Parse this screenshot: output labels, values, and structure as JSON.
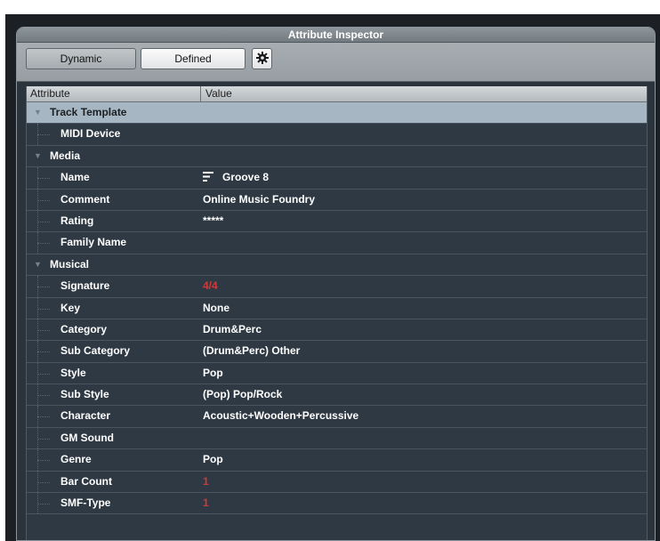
{
  "window": {
    "title": "Attribute Inspector"
  },
  "toolbar": {
    "dynamic_label": "Dynamic",
    "defined_label": "Defined",
    "settings_icon": "gear-icon"
  },
  "columns": {
    "attribute": "Attribute",
    "value": "Value"
  },
  "colors": {
    "panel_bg": "#2b343d",
    "row_text": "#ffffff",
    "selected_row_bg": "#a6b6c2",
    "accent_red": "#cf3a3a"
  },
  "groups": {
    "track_template": {
      "label": "Track Template",
      "items": {
        "midi_device": {
          "label": "MIDI Device",
          "value": ""
        }
      }
    },
    "media": {
      "label": "Media",
      "items": {
        "name": {
          "label": "Name",
          "value": "Groove 8",
          "icon": "lines-icon"
        },
        "comment": {
          "label": "Comment",
          "value": "Online Music Foundry"
        },
        "rating": {
          "label": "Rating",
          "value": "*****"
        },
        "family_name": {
          "label": "Family Name",
          "value": ""
        }
      }
    },
    "musical": {
      "label": "Musical",
      "items": {
        "signature": {
          "label": "Signature",
          "value": "4/4"
        },
        "key": {
          "label": "Key",
          "value": "None"
        },
        "category": {
          "label": "Category",
          "value": "Drum&Perc"
        },
        "sub_category": {
          "label": "Sub Category",
          "value": "(Drum&Perc) Other"
        },
        "style": {
          "label": "Style",
          "value": "Pop"
        },
        "sub_style": {
          "label": "Sub Style",
          "value": "(Pop) Pop/Rock"
        },
        "character": {
          "label": "Character",
          "value": "Acoustic+Wooden+Percussive"
        },
        "gm_sound": {
          "label": "GM Sound",
          "value": ""
        },
        "genre": {
          "label": "Genre",
          "value": "Pop"
        },
        "bar_count": {
          "label": "Bar Count",
          "value": "1"
        },
        "smf_type": {
          "label": "SMF-Type",
          "value": "1"
        }
      }
    }
  }
}
